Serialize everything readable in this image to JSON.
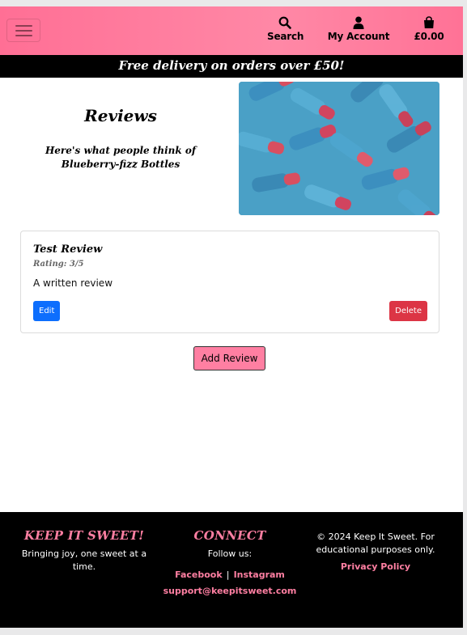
{
  "nav": {
    "search_label": "Search",
    "account_label": "My Account",
    "cart_label": "£0.00",
    "icons": {
      "menu": "hamburger-icon",
      "search": "search-icon",
      "account": "user-icon",
      "cart": "shopping-bag-icon"
    }
  },
  "banner": {
    "text": "Free delivery on orders over £50!"
  },
  "main": {
    "title": "Reviews",
    "subtitle": "Here's what people think of Blueberry-fizz Bottles"
  },
  "reviews": [
    {
      "title": "Test Review",
      "rating": "Rating: 3/5",
      "text": "A written review",
      "edit_label": "Edit",
      "delete_label": "Delete"
    }
  ],
  "add_review_label": "Add Review",
  "footer": {
    "brand": "KEEP IT SWEET!",
    "tagline": "Bringing joy, one sweet at a time.",
    "connect_heading": "CONNECT",
    "follow_label": "Follow us:",
    "facebook": "Facebook",
    "separator": "|",
    "instagram": "Instagram",
    "email": "support@keepitsweet.com",
    "copyright": "© 2024 Keep It Sweet. For educational purposes only.",
    "privacy": "Privacy Policy"
  },
  "colors": {
    "accent_pink": "#ff7fa2",
    "edit_blue": "#0d6efd",
    "delete_red": "#dc3545"
  }
}
